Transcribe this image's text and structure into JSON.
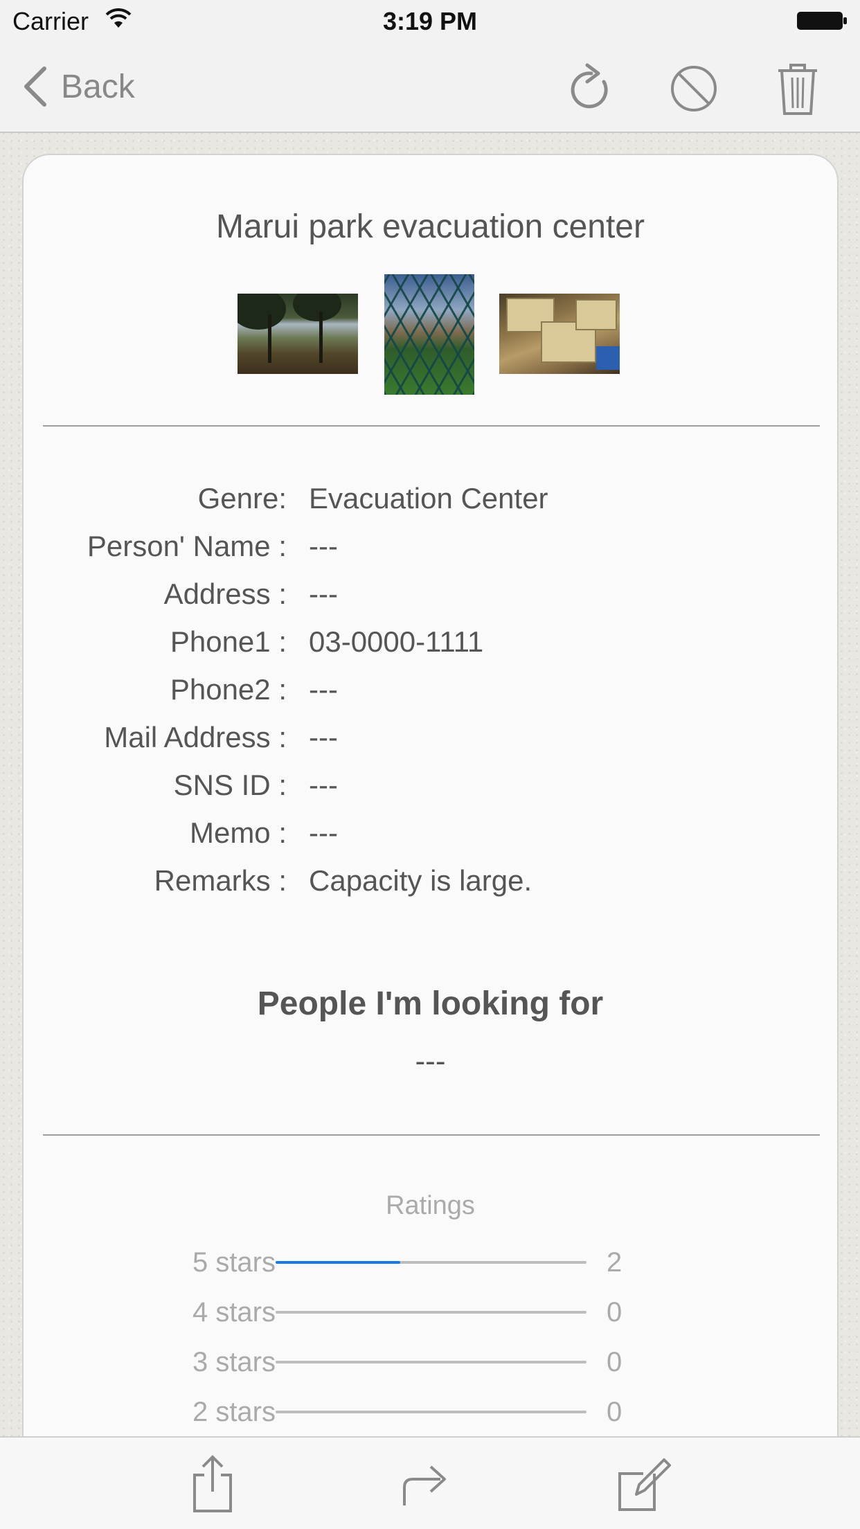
{
  "status_bar": {
    "carrier": "Carrier",
    "time": "3:19 PM"
  },
  "nav": {
    "back_label": "Back",
    "icons": [
      "refresh-icon",
      "block-icon",
      "trash-icon"
    ],
    "icon_color": "#8a8a8a"
  },
  "card": {
    "title": "Marui park evacuation center",
    "fields": [
      {
        "label": "Genre:",
        "value": "Evacuation Center"
      },
      {
        "label": "Person' Name :",
        "value": "---"
      },
      {
        "label": "Address :",
        "value": "---"
      },
      {
        "label": "Phone1 :",
        "value": "03-0000-1111"
      },
      {
        "label": "Phone2 :",
        "value": "---"
      },
      {
        "label": "Mail Address :",
        "value": "---"
      },
      {
        "label": "SNS ID :",
        "value": "---"
      },
      {
        "label": "Memo :",
        "value": "---"
      },
      {
        "label": "Remarks :",
        "value": "Capacity is large."
      }
    ],
    "looking_for": {
      "heading": "People I'm looking for",
      "value": "---"
    },
    "ratings": {
      "title": "Ratings",
      "rows": [
        {
          "label": "5 stars",
          "count": "2",
          "fill": 0.4
        },
        {
          "label": "4 stars",
          "count": "0",
          "fill": 0
        },
        {
          "label": "3 stars",
          "count": "0",
          "fill": 0
        },
        {
          "label": "2 stars",
          "count": "0",
          "fill": 0
        }
      ],
      "fill_color": "#1a7be8"
    }
  },
  "toolbar": {
    "icons": [
      "share-icon",
      "forward-icon",
      "edit-icon"
    ]
  }
}
